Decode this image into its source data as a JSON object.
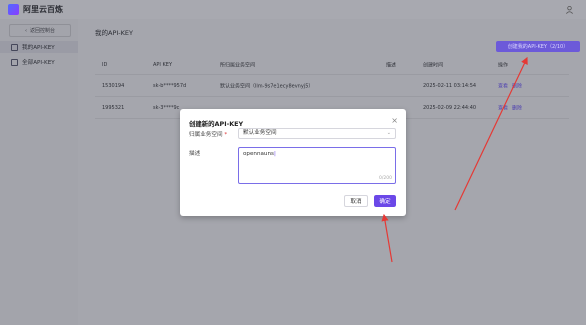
{
  "app": {
    "brand": "阿里云百炼"
  },
  "sidebar": {
    "back_label": "返回控制台",
    "items": [
      {
        "label": "我的API-KEY",
        "active": true
      },
      {
        "label": "全部API-KEY",
        "active": false
      }
    ]
  },
  "main": {
    "title": "我的API-KEY",
    "create_button": "创建我的API-KEY（2/10）",
    "table": {
      "headers": [
        "ID",
        "API KEY",
        "所归属业务空间",
        "描述",
        "创建时间",
        "操作"
      ],
      "rows": [
        {
          "id": "1530194",
          "key": "sk-b****957d",
          "workspace": "默认业务空间（llm-9s7e1ecy8evnyj5）",
          "desc": "",
          "created": "2025-02-11 03:14:54",
          "actions": [
            "查看",
            "删除"
          ]
        },
        {
          "id": "1995321",
          "key": "sk-3****9c",
          "workspace": "",
          "desc": "",
          "created": "2025-02-09 22:44:40",
          "actions": [
            "查看",
            "删除"
          ]
        }
      ]
    }
  },
  "modal": {
    "title": "创建新的API-KEY",
    "workspace_label": "归属业务空间",
    "workspace_value": "默认业务空间",
    "desc_label": "描述",
    "desc_value": "opennauns",
    "counter": "0/200",
    "cancel_label": "取消",
    "ok_label": "确定"
  },
  "colors": {
    "accent": "#6b48e8",
    "arrow": "#e53935"
  }
}
